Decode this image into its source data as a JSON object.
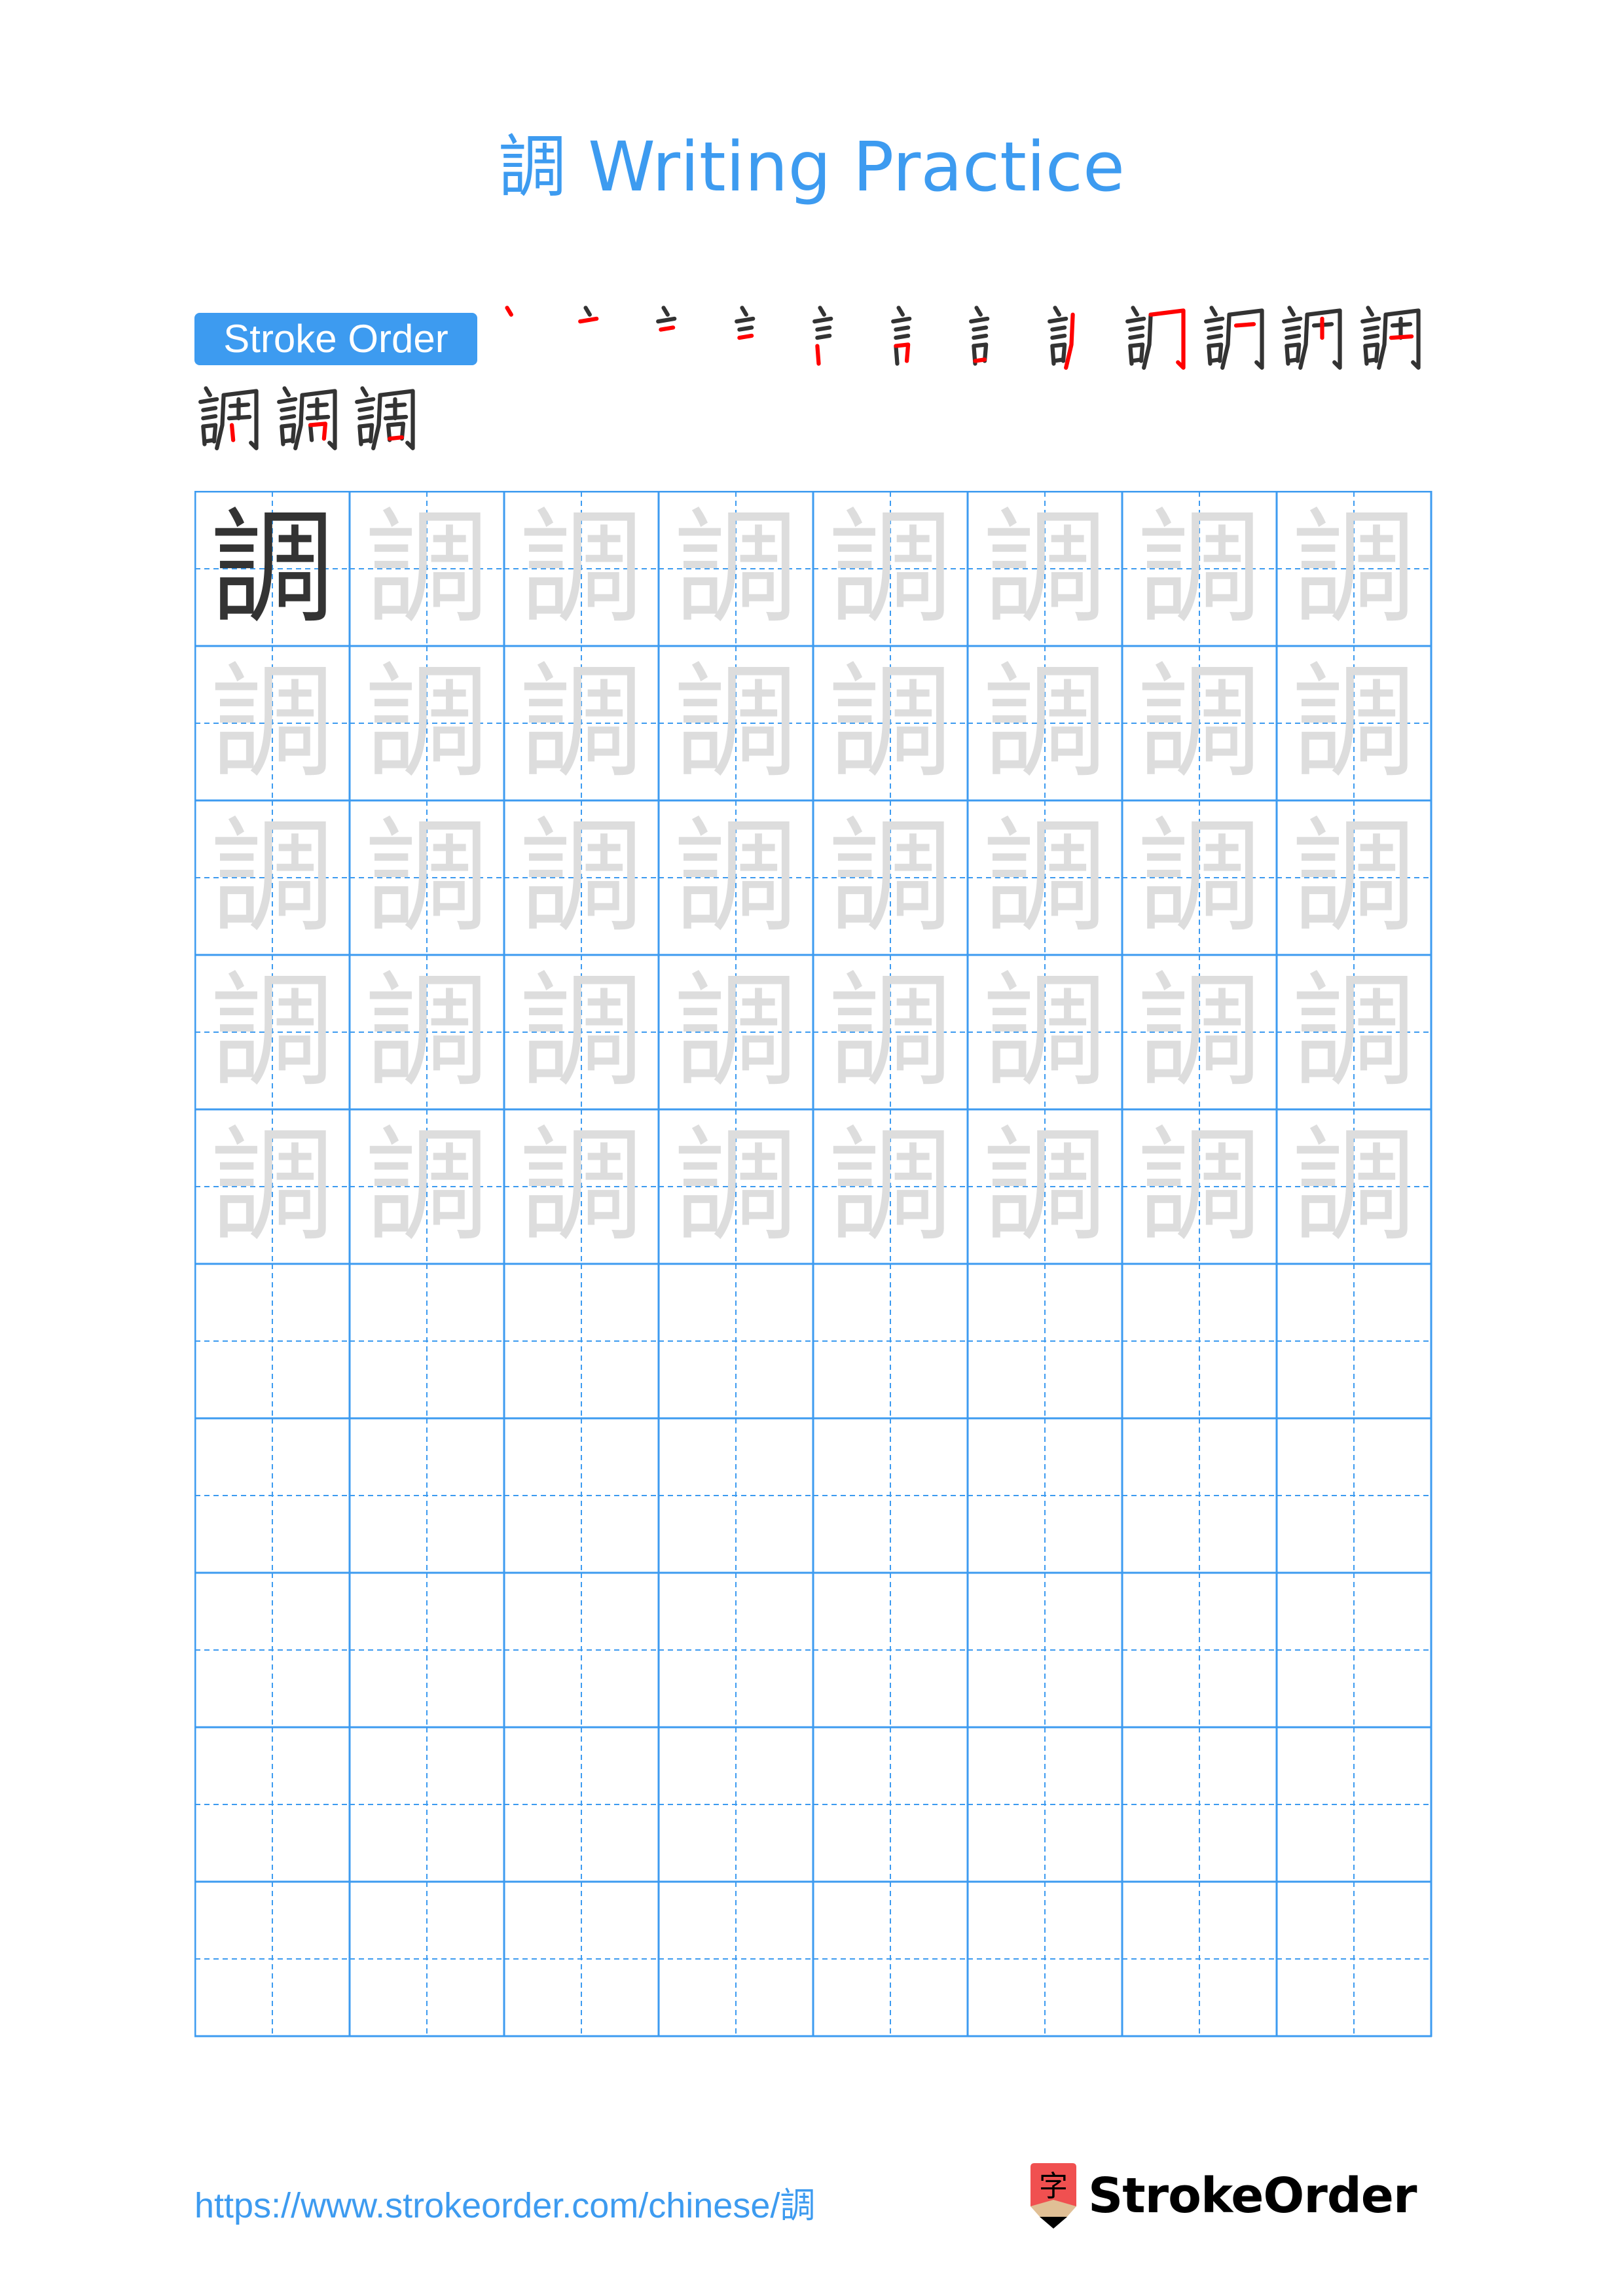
{
  "page": {
    "character": "調",
    "title_suffix": "Writing Practice"
  },
  "colors": {
    "accent": "#3d9bf0",
    "ink": "#333333",
    "highlight": "#ff0000",
    "trace": "#dddddd",
    "logo_red": "#f05050",
    "logo_tan": "#e0bf95"
  },
  "stroke_order": {
    "label": "Stroke Order",
    "total_strokes": 15,
    "steps": [
      {
        "n": 1
      },
      {
        "n": 2
      },
      {
        "n": 3
      },
      {
        "n": 4
      },
      {
        "n": 5
      },
      {
        "n": 6
      },
      {
        "n": 7
      },
      {
        "n": 8
      },
      {
        "n": 9
      },
      {
        "n": 10
      },
      {
        "n": 11
      },
      {
        "n": 12
      },
      {
        "n": 13
      },
      {
        "n": 14
      },
      {
        "n": 15
      }
    ]
  },
  "practice_grid": {
    "columns": 8,
    "rows": 10,
    "model_cells": 1,
    "trace_rows": 5,
    "empty_rows": 5
  },
  "footer": {
    "url": "https://www.strokeorder.com/chinese/調",
    "logo_glyph": "字",
    "logo_text": "StrokeOrder"
  }
}
